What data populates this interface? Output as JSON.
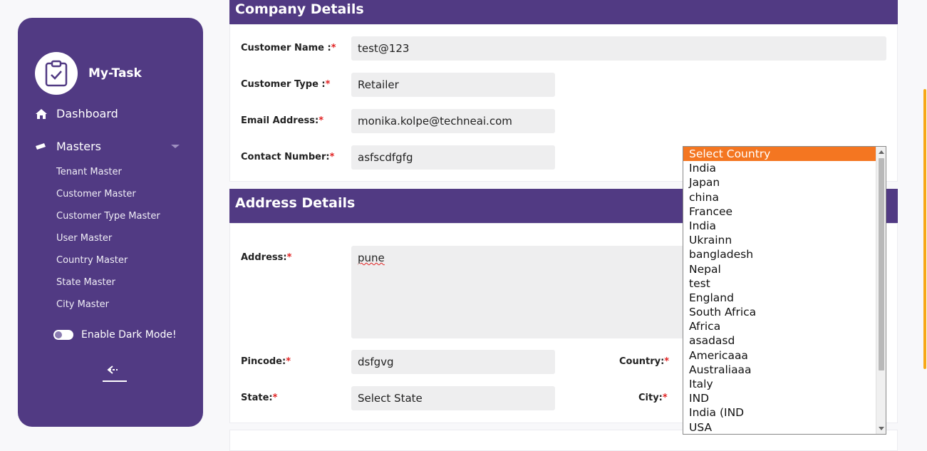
{
  "sidebar": {
    "brand": "My-Task",
    "nav": {
      "dashboard": "Dashboard",
      "masters": "Masters"
    },
    "submenu": [
      "Tenant Master",
      "Customer Master",
      "Customer Type Master",
      "User Master",
      "Country Master",
      "State Master",
      "City Master"
    ],
    "dark_mode_label": "Enable Dark Mode!"
  },
  "company": {
    "title": "Company Details",
    "customer_name_label": "Customer Name :",
    "customer_name": "test@123",
    "customer_type_label": "Customer Type :",
    "customer_type": "Retailer",
    "email_label": "Email Address:",
    "email": "monika.kolpe@techneai.com",
    "contact_label": "Contact Number:",
    "contact": "asfscdfgfg"
  },
  "address": {
    "title": "Address Details",
    "address_label": "Address:",
    "address": "pune",
    "pincode_label": "Pincode:",
    "pincode": "dsfgvg",
    "country_label": "Country:",
    "state_label": "State:",
    "state": "Select State",
    "city_label": "City:"
  },
  "required_mark": "*",
  "country_dropdown": {
    "options": [
      "Select Country",
      "India",
      "Japan",
      "china",
      "Francee",
      "India",
      "Ukrainn",
      "bangladesh",
      "Nepal",
      "test",
      "England",
      "South Africa",
      "Africa",
      "asadasd",
      "Americaaa",
      "Australiaaa",
      "Italy",
      "IND",
      "India (IND",
      "USA"
    ],
    "selected": "Select Country"
  },
  "colors": {
    "primary": "#513a83",
    "highlight": "#f47621",
    "required": "#e02020",
    "scroll_accent": "#f7a817"
  }
}
